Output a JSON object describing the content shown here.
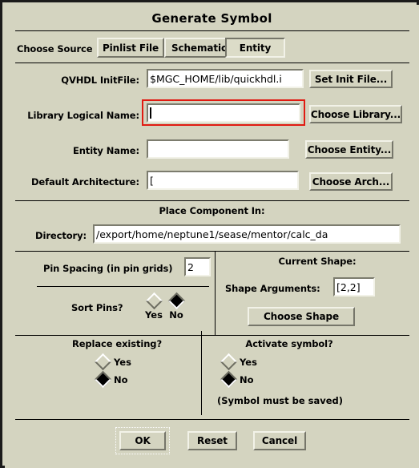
{
  "window": {
    "title": "Generate Symbol"
  },
  "source": {
    "label": "Choose Source",
    "options": [
      {
        "label": "Pinlist File",
        "selected": false
      },
      {
        "label": "Schematic",
        "selected": false
      },
      {
        "label": "Entity",
        "selected": true
      }
    ]
  },
  "fields": {
    "qvhdl_initfile": {
      "label": "QVHDL InitFile:",
      "value": "$MGC_HOME/lib/quickhdl.i",
      "button": "Set Init File...",
      "focused": false
    },
    "library_logical_name": {
      "label": "Library Logical Name:",
      "value": "",
      "button": "Choose Library...",
      "focused": true,
      "highlight_color": "#e01b12"
    },
    "entity_name": {
      "label": "Entity Name:",
      "value": "",
      "button": "Choose Entity...",
      "focused": false
    },
    "default_architecture": {
      "label": "Default Architecture:",
      "value": "[",
      "button": "Choose Arch...",
      "focused": false
    }
  },
  "place_component": {
    "heading": "Place Component In:",
    "directory_label": "Directory:",
    "directory_value": "/export/home/neptune1/sease/mentor/calc_da"
  },
  "pin_section": {
    "pin_spacing_label": "Pin Spacing (in pin grids)",
    "pin_spacing_value": "2",
    "sort_pins_label": "Sort Pins?",
    "sort_pins_yes": "Yes",
    "sort_pins_no": "No",
    "sort_pins_selected": "No"
  },
  "shape_section": {
    "heading": "Current Shape:",
    "shape_arguments_label": "Shape Arguments:",
    "shape_arguments_value": "[2,2]",
    "choose_shape_button": "Choose Shape"
  },
  "replace_section": {
    "heading": "Replace existing?",
    "yes": "Yes",
    "no": "No",
    "selected": "No"
  },
  "activate_section": {
    "heading": "Activate symbol?",
    "yes": "Yes",
    "no": "No",
    "selected": "No",
    "note": "(Symbol must be saved)"
  },
  "actions": {
    "ok": "OK",
    "reset": "Reset",
    "cancel": "Cancel",
    "default_action": "OK"
  },
  "theme": {
    "background": "#d4d4c0",
    "field_background": "#ffffff",
    "text": "#000000",
    "highlight": "#e01b12"
  }
}
